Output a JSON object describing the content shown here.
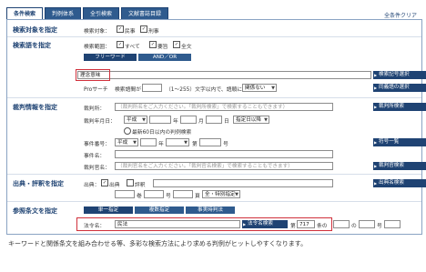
{
  "tabs": [
    "条件検索",
    "判例体系",
    "全引検索",
    "文献書誌目録"
  ],
  "top_right": "全条件クリア",
  "sec1": {
    "title": "検索対象を指定",
    "label": "検索対象：",
    "opts": [
      "民事",
      "刑事"
    ]
  },
  "sec2": {
    "title": "検索語を指定",
    "range_label": "検索範囲：",
    "opts": [
      "すべて",
      "要旨",
      "全文"
    ],
    "subtabs": [
      "フリーワード",
      "AND／OR"
    ],
    "keyword": "理念意味",
    "pro_label": "Proサーチ",
    "pro_text": "検索語間が",
    "pro_hint": "（1〜255）文字以内で、語順に",
    "pro_select": "関係ない",
    "btn1": "検索記号選択",
    "btn2": "同義語の選択"
  },
  "sec3": {
    "title": "裁判情報を指定",
    "court_label": "裁判所：",
    "court_ph": "（裁判所名をご入力ください。「裁判所検索」で検索することもできます）",
    "court_btn": "裁判所検索",
    "date_label": "裁判年月日：",
    "era": "平成",
    "year": "年",
    "month": "月",
    "day": "日",
    "cond": "指定日以降",
    "recent": "最新60日以内の判例検索",
    "case_label": "事件番号：",
    "case_era": "平成",
    "case_year": "年",
    "case_no": "第",
    "case_go": "号",
    "case_btn": "符号一覧",
    "name_label": "事件名：",
    "judge_label": "裁判官名：",
    "judge_ph": "（裁判官名をご入力ください。「裁判官名検索」で検索することもできます）",
    "judge_btn": "裁判官検索"
  },
  "sec4": {
    "title": "出典・評釈を指定",
    "label": "出典：",
    "opts": [
      "出典",
      "評釈"
    ],
    "vol": "巻",
    "no": "号",
    "page": "頁",
    "page_sel": "全・特別指定",
    "btn": "出典名検索"
  },
  "sec5": {
    "title": "参照条文を指定",
    "subtabs": [
      "単一指定",
      "複数指定",
      "事実時判法"
    ],
    "law_label": "法令名：",
    "law_value": "民法",
    "law_btn": "法令名検索",
    "article": "第",
    "article_val": "717",
    "art_suf": "条の",
    "para": "の",
    "item": "号"
  },
  "caption": "キーワードと関係条文を組み合わせる等、多彩な検索方法により求める判例がヒットしやすくなります。"
}
